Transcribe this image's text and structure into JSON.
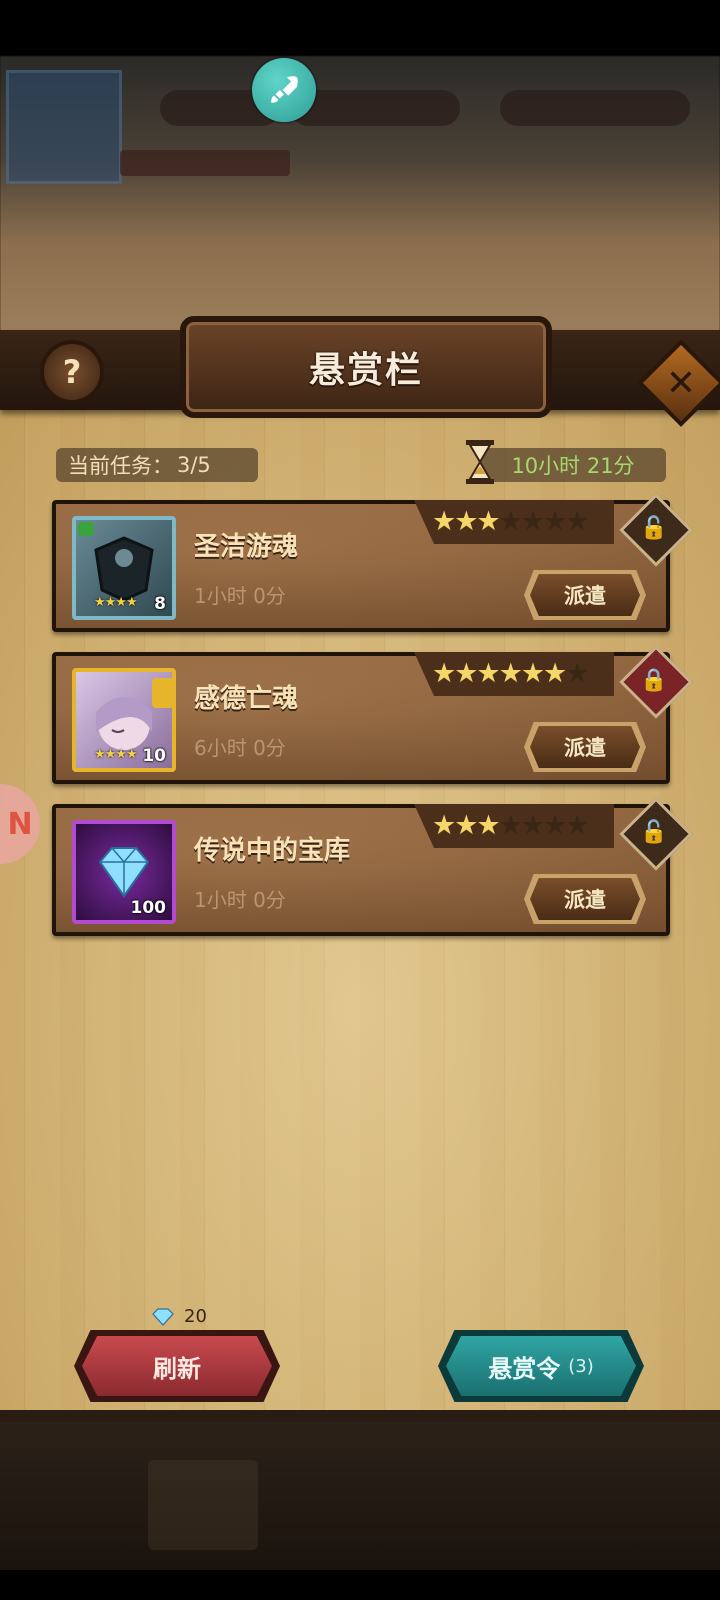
{
  "header": {
    "title": "悬赏栏",
    "help_label": "?",
    "close_label": "✕"
  },
  "status": {
    "tasks_label": "当前任务：",
    "tasks_value": "3/5",
    "timer": "10小时 21分"
  },
  "missions": [
    {
      "name": "圣洁游魂",
      "duration": "1小时 0分",
      "stars_on": 3,
      "stars_total": 7,
      "reward_count": "8",
      "reward_stars": "★★★★",
      "dispatch_label": "派遣",
      "locked": false
    },
    {
      "name": "感德亡魂",
      "duration": "6小时 0分",
      "stars_on": 6,
      "stars_total": 7,
      "reward_count": "10",
      "reward_stars": "★★★★",
      "dispatch_label": "派遣",
      "locked": true
    },
    {
      "name": "传说中的宝库",
      "duration": "1小时 0分",
      "stars_on": 3,
      "stars_total": 7,
      "reward_count": "100",
      "reward_stars": "",
      "dispatch_label": "派遣",
      "locked": false
    }
  ],
  "footer": {
    "refresh_cost": "20",
    "refresh_label": "刷新",
    "bounty_label": "悬赏令",
    "bounty_count": "(3)"
  },
  "colors": {
    "accent_teal": "#2fa6a3",
    "accent_red": "#c84a4f",
    "timer_green": "#a6d86e"
  }
}
